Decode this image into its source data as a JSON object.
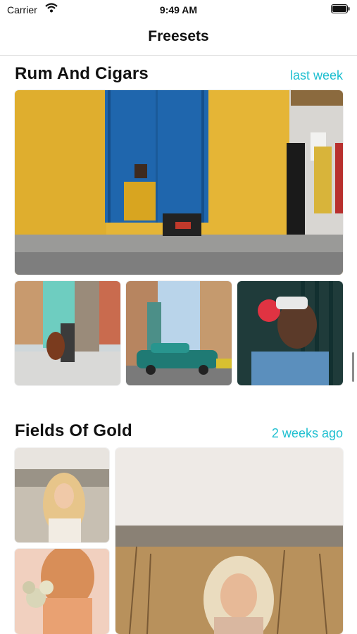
{
  "status_bar": {
    "carrier": "Carrier",
    "time": "9:49 AM"
  },
  "nav": {
    "title": "Freesets"
  },
  "sections": [
    {
      "title": "Rum And Cigars",
      "date": "last week",
      "photos": [
        "trumpet-player-blue-door",
        "cello-street",
        "teal-vintage-car",
        "woman-with-cigar"
      ]
    },
    {
      "title": "Fields Of Gold",
      "date": "2 weeks ago",
      "photos": [
        "blonde-girl-field",
        "girl-with-flowers",
        "girl-in-wheat-field"
      ]
    }
  ],
  "colors": {
    "accent": "#1fbfd0",
    "divider": "#dedede"
  }
}
